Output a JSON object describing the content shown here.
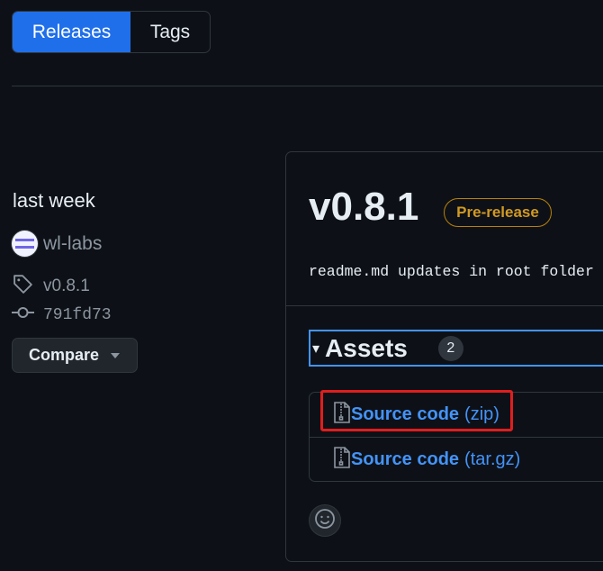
{
  "tabs": {
    "releases_label": "Releases",
    "tags_label": "Tags"
  },
  "sidebar": {
    "date": "last week",
    "author": "wl-labs",
    "tag": "v0.8.1",
    "commit": "791fd73",
    "compare_label": "Compare"
  },
  "release": {
    "version": "v0.8.1",
    "badge": "Pre-release",
    "notes": "readme.md updates in root folder",
    "assets": {
      "title": "Assets",
      "count": "2",
      "items": [
        {
          "name": "Source code",
          "format": "(zip)"
        },
        {
          "name": "Source code",
          "format": "(tar.gz)"
        }
      ]
    }
  },
  "colors": {
    "accent": "#1f6feb",
    "link": "#4493f8",
    "prerelease": "#d29922",
    "highlight": "#e01e1e",
    "background": "#0d1117"
  },
  "icons": [
    "tag-icon",
    "commit-icon",
    "zip-file-icon",
    "smiley-icon",
    "caret-down-icon"
  ]
}
